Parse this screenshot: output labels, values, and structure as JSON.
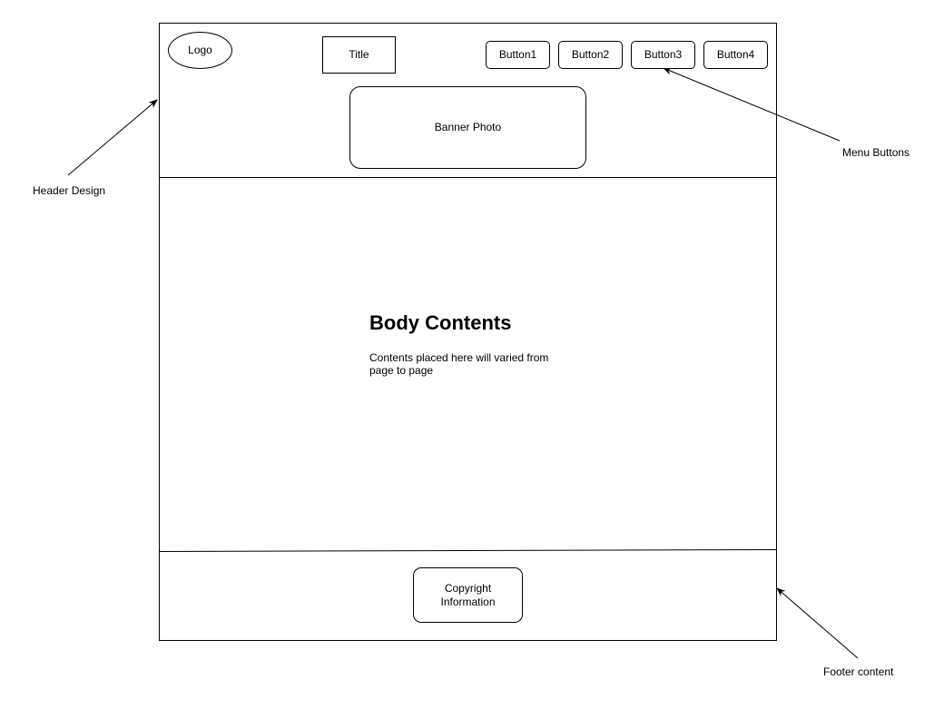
{
  "header": {
    "logo_label": "Logo",
    "title_label": "Title",
    "menu_buttons": [
      "Button1",
      "Button2",
      "Button3",
      "Button4"
    ],
    "banner_label": "Banner Photo"
  },
  "body": {
    "heading": "Body Contents",
    "text": "Contents placed here will varied from page to page"
  },
  "footer": {
    "copyright_label": "Copyright Information"
  },
  "annotations": {
    "header": "Header Design",
    "menu": "Menu Buttons",
    "footer": "Footer content"
  },
  "colors": {
    "stroke": "#000000",
    "background": "#ffffff"
  }
}
